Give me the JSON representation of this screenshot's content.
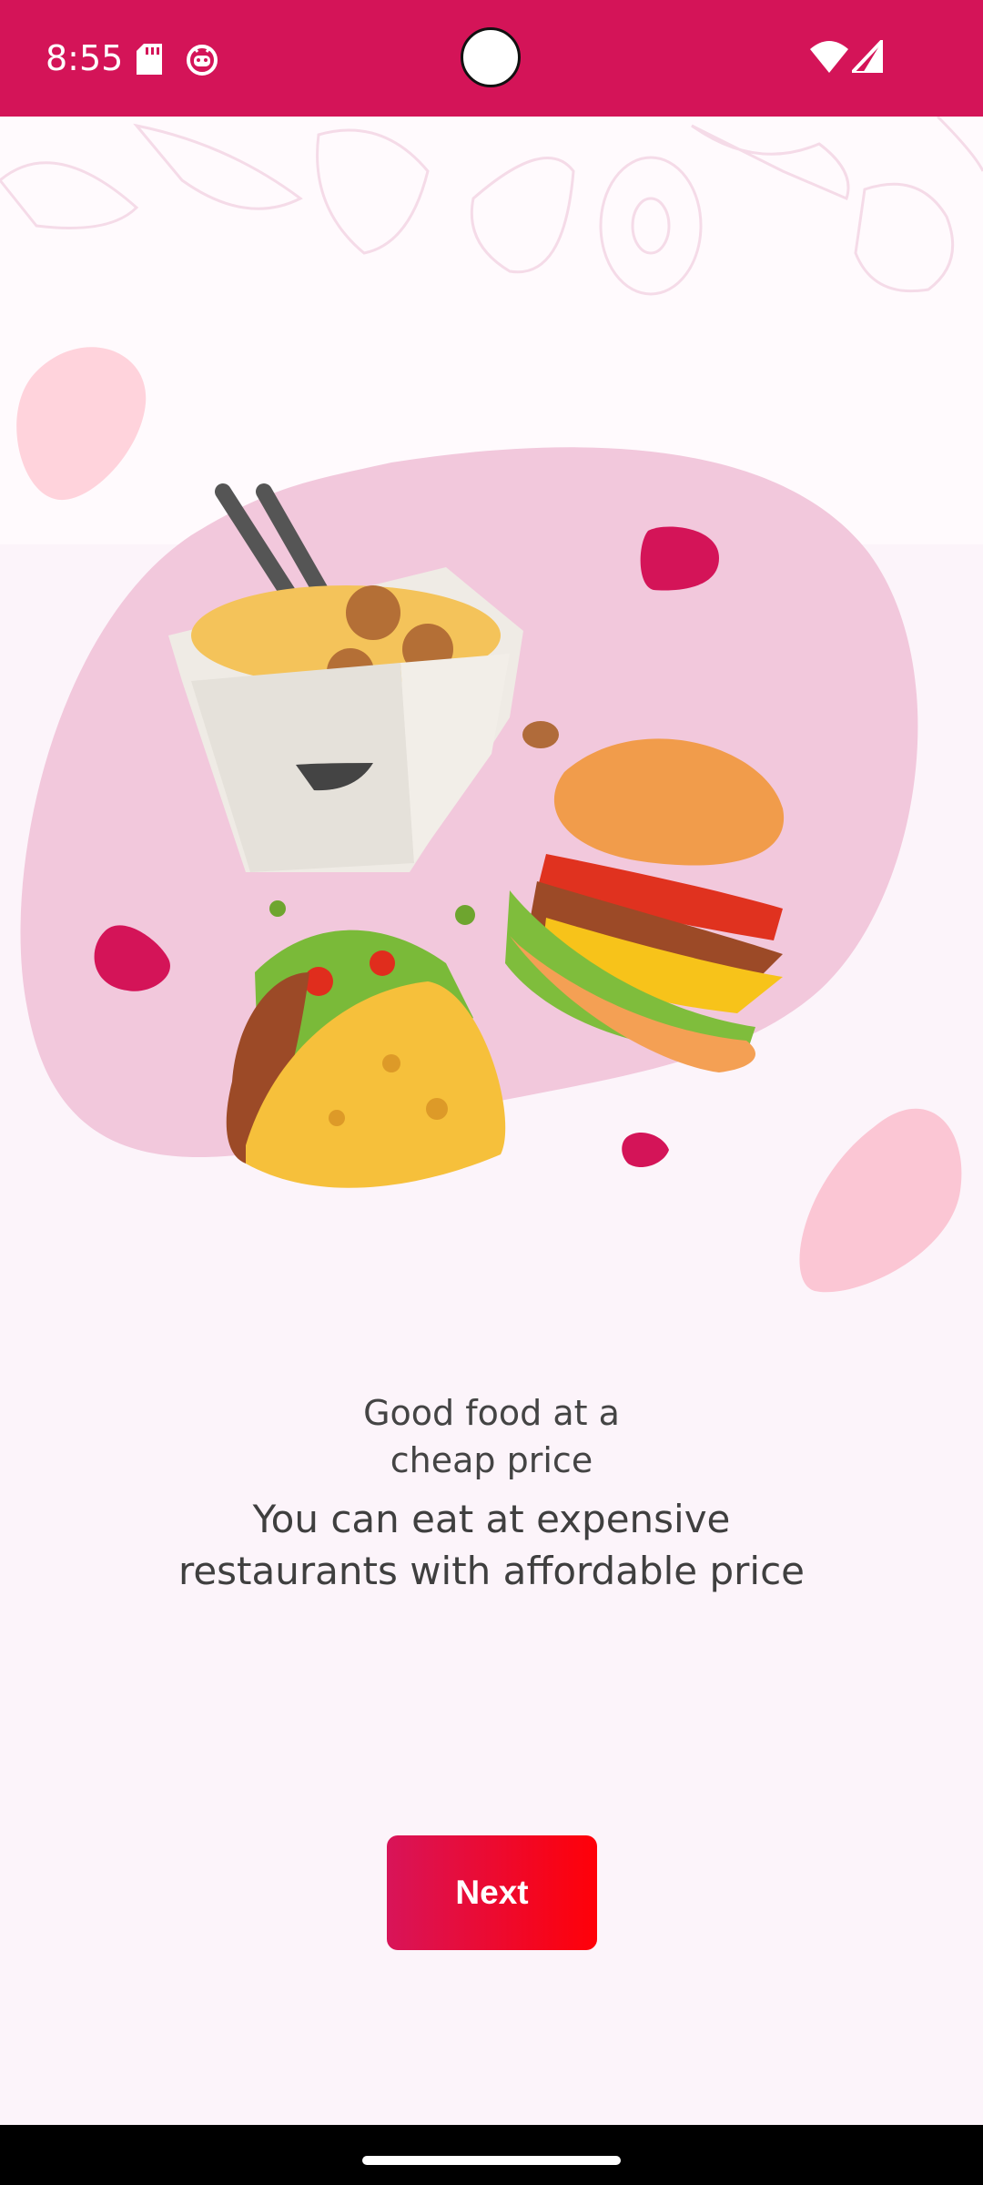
{
  "status_bar": {
    "time": "8:55",
    "icons": [
      "sd-card-icon",
      "bug-icon",
      "wifi-icon",
      "signal-icon"
    ],
    "background": "#d41458"
  },
  "onboarding": {
    "headline": "Good food at a\ncheap price",
    "subline": "You can eat at expensive restaurants with affordable price",
    "next_label": "Next",
    "illustration_items": [
      "noodle-box-icon",
      "burger-icon",
      "taco-icon"
    ]
  },
  "colors": {
    "accent": "#d41458",
    "button_start": "#d81459",
    "button_end": "#ff0008",
    "background": "#fcf4fa",
    "blob": "#f2c8dc"
  }
}
